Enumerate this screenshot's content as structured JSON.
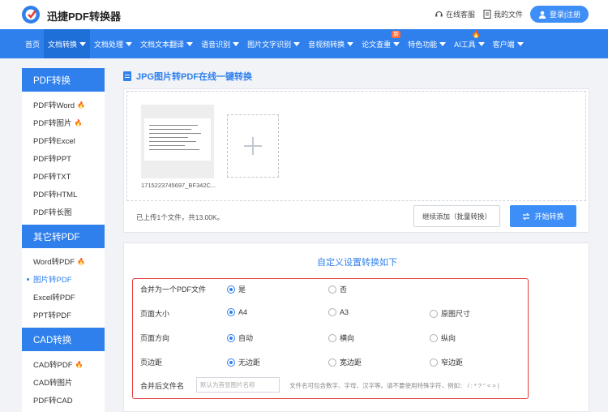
{
  "header": {
    "app_name": "迅捷PDF转换器",
    "support_label": "在线客服",
    "my_files_label": "我的文件",
    "login_label": "登录|注册"
  },
  "nav": {
    "items": [
      {
        "label": "首页",
        "has_caret": false
      },
      {
        "label": "文档转换",
        "has_caret": true,
        "active": true
      },
      {
        "label": "文档处理",
        "has_caret": true
      },
      {
        "label": "文档文本翻译",
        "has_caret": true
      },
      {
        "label": "语音识别",
        "has_caret": true
      },
      {
        "label": "图片文字识别",
        "has_caret": true
      },
      {
        "label": "音视频转换",
        "has_caret": true
      },
      {
        "label": "论文查重",
        "has_caret": true,
        "badge": "新"
      },
      {
        "label": "特色功能",
        "has_caret": true
      },
      {
        "label": "AI工具",
        "has_caret": true
      },
      {
        "label": "客户端",
        "has_caret": true
      }
    ]
  },
  "sidebar": {
    "sections": [
      {
        "title": "PDF转换",
        "items": [
          {
            "label": "PDF转Word",
            "hot": true
          },
          {
            "label": "PDF转图片",
            "hot": true
          },
          {
            "label": "PDF转Excel"
          },
          {
            "label": "PDF转PPT"
          },
          {
            "label": "PDF转TXT"
          },
          {
            "label": "PDF转HTML"
          },
          {
            "label": "PDF转长图"
          }
        ]
      },
      {
        "title": "其它转PDF",
        "items": [
          {
            "label": "Word转PDF",
            "hot": true
          },
          {
            "label": "图片转PDF",
            "active": true
          },
          {
            "label": "Excel转PDF"
          },
          {
            "label": "PPT转PDF"
          }
        ]
      },
      {
        "title": "CAD转换",
        "items": [
          {
            "label": "CAD转PDF",
            "hot": true
          },
          {
            "label": "CAD转图片"
          },
          {
            "label": "PDF转CAD"
          }
        ]
      }
    ]
  },
  "main": {
    "title": "JPG图片转PDF在线一键转换",
    "file_name": "1715223745697_BF342C...",
    "upload_status": "已上传1个文件，共13.00K。",
    "continue_btn": "继续添加（批量转换）",
    "start_btn": "开始转换"
  },
  "settings": {
    "title": "自定义设置转换如下",
    "rows": [
      {
        "label": "合并为一个PDF文件",
        "options": [
          "是",
          "否"
        ],
        "selected": 0
      },
      {
        "label": "页面大小",
        "options": [
          "A4",
          "A3",
          "原图尺寸"
        ],
        "selected": 0
      },
      {
        "label": "页面方向",
        "options": [
          "自动",
          "横向",
          "纵向"
        ],
        "selected": 0
      },
      {
        "label": "页边距",
        "options": [
          "无边距",
          "宽边距",
          "窄边距"
        ],
        "selected": 0
      }
    ],
    "filename_label": "合并后文件名",
    "filename_placeholder": "默认为首张图片名称",
    "filename_hint": "文件名可包含数字、字母、汉字等。请不要使用特殊字符，例如： / : * ? \" < > |"
  },
  "colors": {
    "primary": "#2f80ed",
    "highlight_border": "#e23b3b",
    "hot": "#ff5a2a"
  }
}
